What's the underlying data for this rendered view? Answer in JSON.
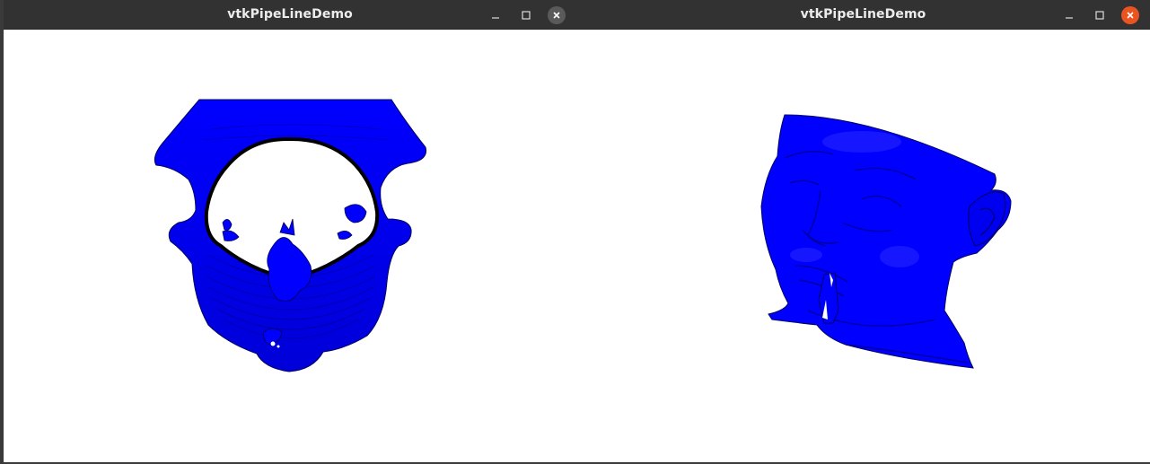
{
  "windows": [
    {
      "title": "vtkPipeLineDemo",
      "close_bg": "#5a5a5a",
      "render_color": "#0000ff"
    },
    {
      "title": "vtkPipeLineDemo",
      "close_bg": "#e95420",
      "render_color": "#0000ff"
    }
  ],
  "icons": {
    "minimize": "minimize-icon",
    "maximize": "maximize-icon",
    "close": "close-icon"
  }
}
